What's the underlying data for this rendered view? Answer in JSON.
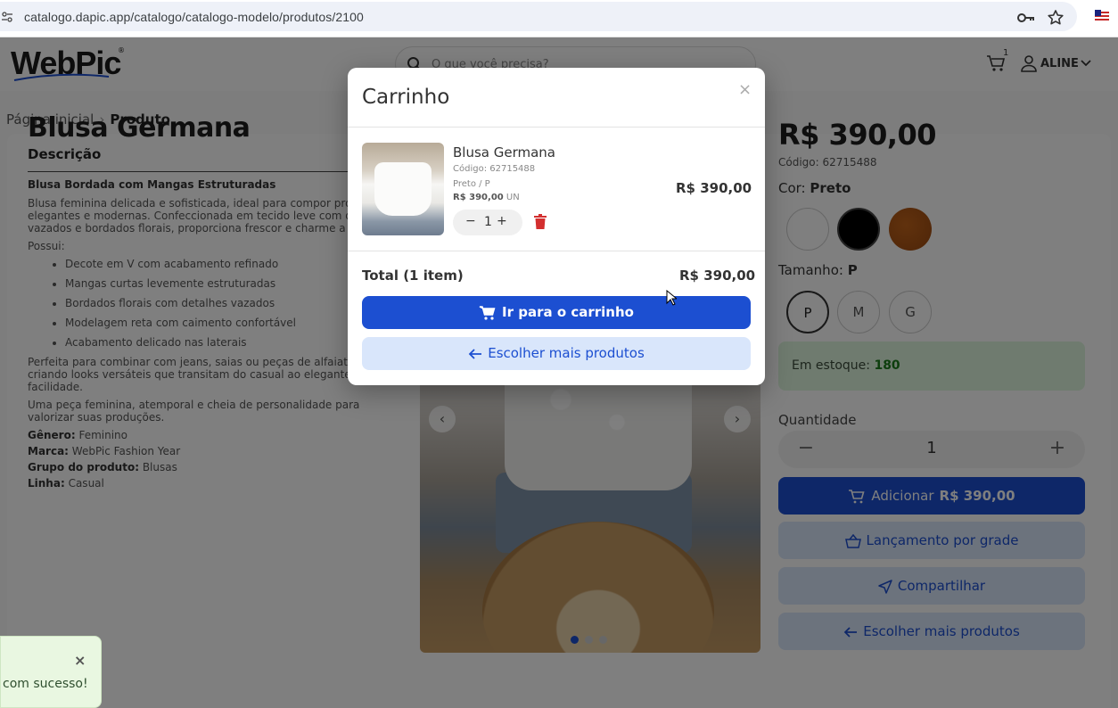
{
  "browser": {
    "url": "catalogo.dapic.app/catalogo/catalogo-modelo/produtos/2100"
  },
  "header": {
    "logo": "WebPic",
    "logo_mark": "®",
    "search_placeholder": "O que você precisa?",
    "cart_count": "1",
    "user_name": "ALINE"
  },
  "breadcrumb": {
    "home": "Página inicial",
    "separator": "›",
    "current": "Produto"
  },
  "product": {
    "title": "Blusa Germana",
    "description_heading": "Descrição",
    "description_title": "Blusa Bordada com Mangas Estruturadas",
    "description_intro": "Blusa feminina delicada e sofisticada, ideal para compor pro elegantes e modernas. Confeccionada em tecido leve com d vazados e bordados florais, proporciona frescor e charme a",
    "features_label": "Possui:",
    "features": [
      "Decote em V com acabamento refinado",
      "Mangas curtas levemente estruturadas",
      "Bordados florais com detalhes vazados",
      "Modelagem reta com caimento confortável",
      "Acabamento delicado nas laterais"
    ],
    "combine_text": "Perfeita para combinar com jeans, saias ou peças de alfaiataria, criando looks versáteis que transitam do casual ao elegante com facilidade.",
    "closing_text": "Uma peça feminina, atemporal e cheia de personalidade para valorizar suas produções.",
    "specs": [
      {
        "label": "Gênero:",
        "value": "Feminino"
      },
      {
        "label": "Marca:",
        "value": "WebPic Fashion Year"
      },
      {
        "label": "Grupo do produto:",
        "value": "Blusas"
      },
      {
        "label": "Linha:",
        "value": "Casual"
      }
    ],
    "price": "R$ 390,00",
    "code": "Código: 62715488",
    "color_label": "Cor:",
    "color_value": "Preto",
    "size_label": "Tamanho:",
    "size_value": "P",
    "sizes": [
      "P",
      "M",
      "G"
    ],
    "stock_label": "Em estoque:",
    "stock_value": "180",
    "quantity_label": "Quantidade",
    "quantity_value": "1",
    "qty_minus": "−",
    "qty_plus": "+",
    "add_label": "Adicionar",
    "add_price": "R$ 390,00",
    "grade_label": "Lançamento por grade",
    "share_label": "Compartilhar",
    "more_label": "Escolher mais produtos",
    "carousel_prev": "‹",
    "carousel_next": "›"
  },
  "colors": {
    "accent": "#1c4fd1",
    "secondary_bg": "#d9e6fb",
    "stock_bg": "#def7de",
    "swatch_white": "#ffffff",
    "swatch_black": "#000000",
    "swatch_brown": "#b35a16",
    "trash": "#d32f2f"
  },
  "toast": {
    "close": "×",
    "text": "com sucesso!"
  },
  "modal": {
    "title": "Carrinho",
    "close": "×",
    "item": {
      "name": "Blusa Germana",
      "code": "Código: 62715488",
      "variant": "Preto / P",
      "unit_price": "R$ 390,00",
      "unit": "UN",
      "qty_minus": "−",
      "qty": "1",
      "qty_plus": "+",
      "price": "R$ 390,00"
    },
    "total_label": "Total (1 item)",
    "total_value": "R$ 390,00",
    "primary_button": "Ir para o carrinho",
    "secondary_button": "Escolher mais produtos"
  }
}
